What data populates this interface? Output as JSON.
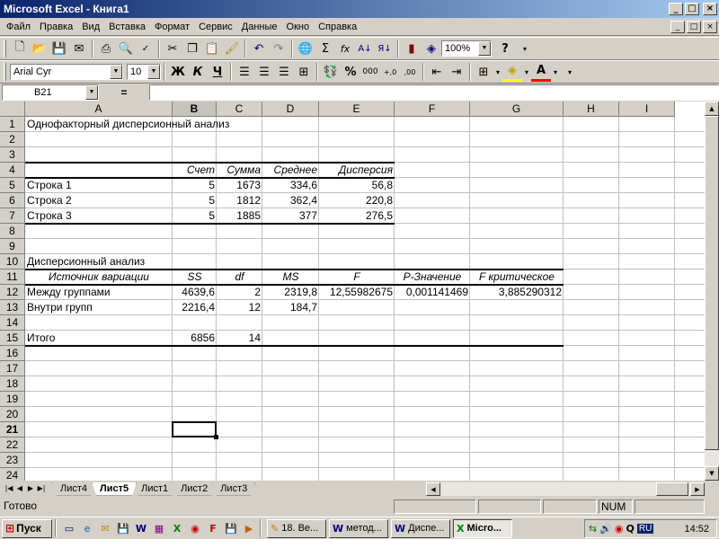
{
  "window": {
    "title": "Microsoft Excel - Книга1",
    "controls": [
      "_",
      "□",
      "×"
    ]
  },
  "menu": {
    "items": [
      "Файл",
      "Правка",
      "Вид",
      "Вставка",
      "Формат",
      "Сервис",
      "Данные",
      "Окно",
      "Справка"
    ]
  },
  "toolbar": {
    "zoom": "100%",
    "font_name": "Arial Cyr",
    "font_size": "10",
    "bold": "Ж",
    "italic": "К",
    "underline": "Ч",
    "percent": "%",
    "thousands": "000",
    "dec_inc": "+,0",
    "dec_dec": ",00",
    "sum": "Σ",
    "func": "fx",
    "help": "?"
  },
  "formula_bar": {
    "name_box": "B21",
    "equals": "=",
    "formula": ""
  },
  "sheet": {
    "columns": [
      "A",
      "B",
      "C",
      "D",
      "E",
      "F",
      "G",
      "H",
      "I"
    ],
    "selected_column": "B",
    "selected_row": "21",
    "rows": [
      "1",
      "2",
      "3",
      "4",
      "5",
      "6",
      "7",
      "8",
      "9",
      "10",
      "11",
      "12",
      "13",
      "14",
      "15",
      "16",
      "17",
      "18",
      "19",
      "20",
      "21",
      "22",
      "23",
      "24"
    ],
    "cells": {
      "A1": "Однофакторный дисперсионный анализ",
      "B4": "Счет",
      "C4": "Сумма",
      "D4": "Среднее",
      "E4": "Дисперсия",
      "A5": "Строка 1",
      "B5": "5",
      "C5": "1673",
      "D5": "334,6",
      "E5": "56,8",
      "A6": "Строка 2",
      "B6": "5",
      "C6": "1812",
      "D6": "362,4",
      "E6": "220,8",
      "A7": "Строка 3",
      "B7": "5",
      "C7": "1885",
      "D7": "377",
      "E7": "276,5",
      "A10": "Дисперсионный анализ",
      "A11": "Источник вариации",
      "B11": "SS",
      "C11": "df",
      "D11": "MS",
      "E11": "F",
      "F11": "P-Значение",
      "G11": "F критическое",
      "A12": "Между группами",
      "B12": "4639,6",
      "C12": "2",
      "D12": "2319,8",
      "E12": "12,55982675",
      "F12": "0,001141469",
      "G12": "3,885290312",
      "A13": "Внутри групп",
      "B13": "2216,4",
      "C13": "12",
      "D13": "184,7",
      "A15": "Итого",
      "B15": "6856",
      "C15": "14"
    }
  },
  "tabs": {
    "nav": [
      "|◀",
      "◀",
      "▶",
      "▶|"
    ],
    "sheets": [
      "Лист4",
      "Лист5",
      "Лист1",
      "Лист2",
      "Лист3"
    ],
    "active": "Лист5"
  },
  "status": {
    "text": "Готово",
    "num": "NUM"
  },
  "taskbar": {
    "start": "Пуск",
    "tasks": [
      {
        "label": "18. Ве...",
        "icon": "✎",
        "active": false
      },
      {
        "label": "метод...",
        "icon": "W",
        "active": false
      },
      {
        "label": "Диспе...",
        "icon": "W",
        "active": false
      },
      {
        "label": "Micro...",
        "icon": "X",
        "active": true
      }
    ],
    "lang": "RU",
    "clock": "14:52"
  }
}
